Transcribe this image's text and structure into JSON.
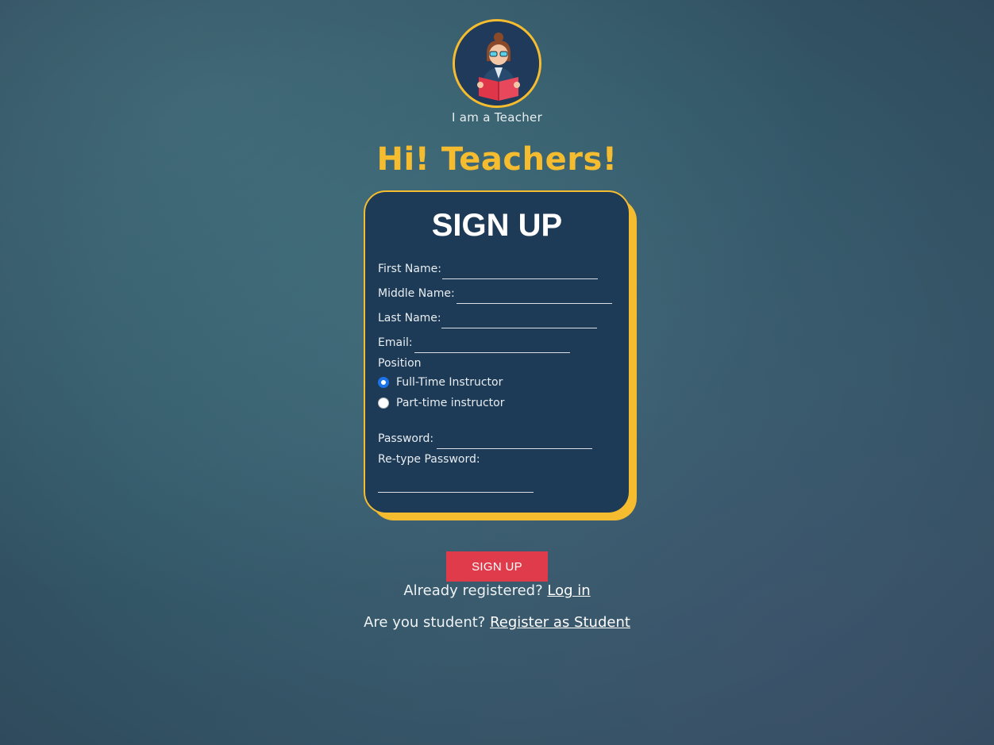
{
  "header": {
    "role_caption": "I am a Teacher",
    "greeting": "Hi! Teachers!"
  },
  "form": {
    "title": "SIGN UP",
    "first_name_label": "First Name:",
    "middle_name_label": "Middle Name:",
    "last_name_label": "Last Name:",
    "email_label": "Email:",
    "position_label": "Position",
    "position_options": [
      {
        "label": "Full-Time Instructor",
        "checked": true
      },
      {
        "label": "Part-time instructor",
        "checked": false
      }
    ],
    "password_label": "Password:",
    "retype_password_label": "Re-type Password:",
    "submit_label": "SIGN UP"
  },
  "footer": {
    "login_prompt": "Already registered?",
    "login_link": "Log in",
    "student_prompt": "Are you student?",
    "student_link": "Register as Student"
  },
  "colors": {
    "accent": "#f5bc30",
    "card": "#1d3a56",
    "button": "#e03b4a",
    "radio_selected": "#1a73e8"
  },
  "icons": {
    "avatar": "teacher-reading-icon"
  }
}
